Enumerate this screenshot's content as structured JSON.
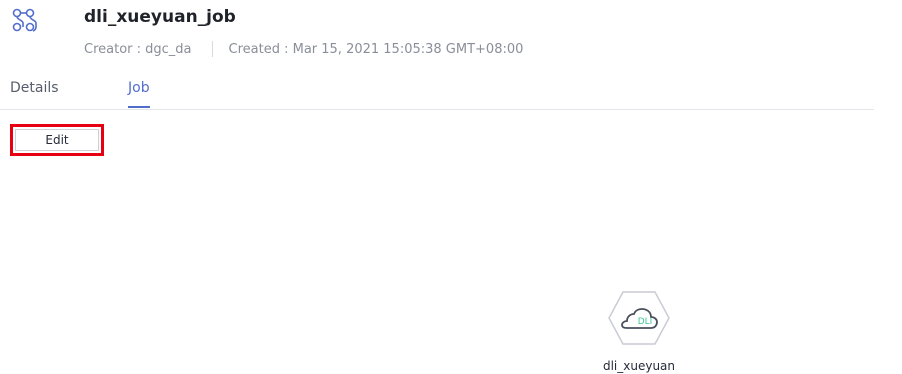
{
  "header": {
    "title": "dli_xueyuan_job",
    "creator_text": "Creator : dgc_da",
    "created_text": "Created : Mar 15, 2021 15:05:38 GMT+08:00",
    "icon": "workflow-icon"
  },
  "tabs": [
    {
      "label": "Details",
      "active": false
    },
    {
      "label": "Job",
      "active": true
    }
  ],
  "toolbar": {
    "edit_label": "Edit"
  },
  "canvas": {
    "node": {
      "label": "dli_xueyuan",
      "badge": "DLI",
      "icon": "dli-cloud-icon"
    }
  },
  "colors": {
    "accent": "#526ecc",
    "highlight_border": "#e60012",
    "node_badge": "#3fc79a"
  }
}
